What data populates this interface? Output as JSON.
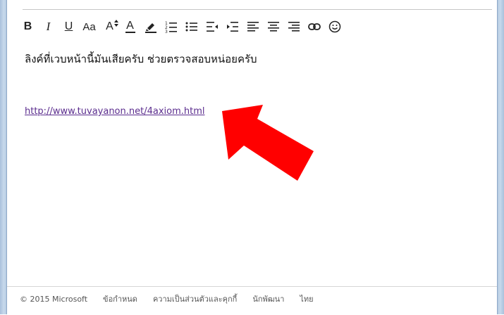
{
  "editor": {
    "toolbar": [
      {
        "name": "bold-button",
        "label": "B",
        "icon": "bold"
      },
      {
        "name": "italic-button",
        "label": "I",
        "icon": "italic"
      },
      {
        "name": "underline-button",
        "label": "U",
        "icon": "underline"
      },
      {
        "name": "font-size-button",
        "label": "Aa",
        "icon": "font-size"
      },
      {
        "name": "grow-font-button",
        "label": "A",
        "icon": "grow-font"
      },
      {
        "name": "font-color-button",
        "label": "A",
        "icon": "font-color"
      },
      {
        "name": "highlight-button",
        "label": "",
        "icon": "highlighter"
      },
      {
        "name": "numbered-list-button",
        "label": "",
        "icon": "numbered-list"
      },
      {
        "name": "bulleted-list-button",
        "label": "",
        "icon": "bulleted-list"
      },
      {
        "name": "decrease-indent-button",
        "label": "",
        "icon": "outdent"
      },
      {
        "name": "increase-indent-button",
        "label": "",
        "icon": "indent"
      },
      {
        "name": "align-left-button",
        "label": "",
        "icon": "align-left"
      },
      {
        "name": "align-center-button",
        "label": "",
        "icon": "align-center"
      },
      {
        "name": "align-right-button",
        "label": "",
        "icon": "align-right"
      },
      {
        "name": "insert-link-button",
        "label": "",
        "icon": "link"
      },
      {
        "name": "emoticon-button",
        "label": "",
        "icon": "smiley"
      }
    ],
    "body_text": "ลิงค์ที่เวบหน้านี้มันเสียครับ ช่วยตรวจสอบหน่อยครับ",
    "link_text": "http://www.tuvayanon.net/4axiom.html"
  },
  "annotation": {
    "icon": "red-arrow-icon",
    "color": "#ff0000"
  },
  "footer": {
    "copyright": "© 2015 Microsoft",
    "links": [
      "ข้อกำหนด",
      "ความเป็นส่วนตัวและคุกกี้",
      "นักพัฒนา",
      "ไทย"
    ]
  },
  "colors": {
    "link": "#5b2d8e",
    "frame": "#b6cbe2"
  }
}
